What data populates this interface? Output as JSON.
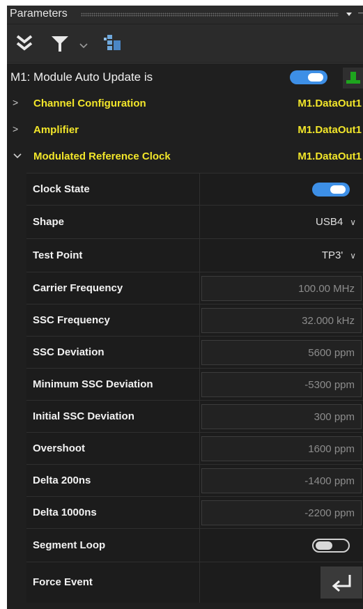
{
  "panel": {
    "title": "Parameters"
  },
  "toolbar": {
    "items": [
      {
        "icon": "collapse-all-icon"
      },
      {
        "icon": "filter-icon"
      },
      {
        "icon": "chevron-down-icon"
      },
      {
        "icon": "module-grid-icon"
      }
    ]
  },
  "module": {
    "label": "M1: Module Auto Update is",
    "auto_update_on": true,
    "colors": {
      "accent": "#3d8fe6",
      "indicator": "#1ea51e"
    }
  },
  "sections": [
    {
      "name": "Channel Configuration",
      "target": "M1.DataOut1",
      "expanded": false
    },
    {
      "name": "Amplifier",
      "target": "M1.DataOut1",
      "expanded": false
    },
    {
      "name": "Modulated Reference Clock",
      "target": "M1.DataOut1",
      "expanded": true
    }
  ],
  "params": {
    "clock_state": {
      "label": "Clock State",
      "on": true
    },
    "shape": {
      "label": "Shape",
      "value": "USB4"
    },
    "test_point": {
      "label": "Test Point",
      "value": "TP3'"
    },
    "carrier_frequency": {
      "label": "Carrier Frequency",
      "value": "100.00 MHz"
    },
    "ssc_frequency": {
      "label": "SSC Frequency",
      "value": "32.000 kHz"
    },
    "ssc_deviation": {
      "label": "SSC Deviation",
      "value": "5600 ppm"
    },
    "min_ssc_deviation": {
      "label": "Minimum SSC Deviation",
      "value": "-5300 ppm"
    },
    "initial_ssc_deviation": {
      "label": "Initial SSC Deviation",
      "value": "300 ppm"
    },
    "overshoot": {
      "label": "Overshoot",
      "value": "1600 ppm"
    },
    "delta_200ns": {
      "label": "Delta 200ns",
      "value": "-1400 ppm"
    },
    "delta_1000ns": {
      "label": "Delta 1000ns",
      "value": "-2200 ppm"
    },
    "segment_loop": {
      "label": "Segment Loop",
      "on": false
    },
    "force_event": {
      "label": "Force Event",
      "button_icon": "enter-icon"
    }
  }
}
